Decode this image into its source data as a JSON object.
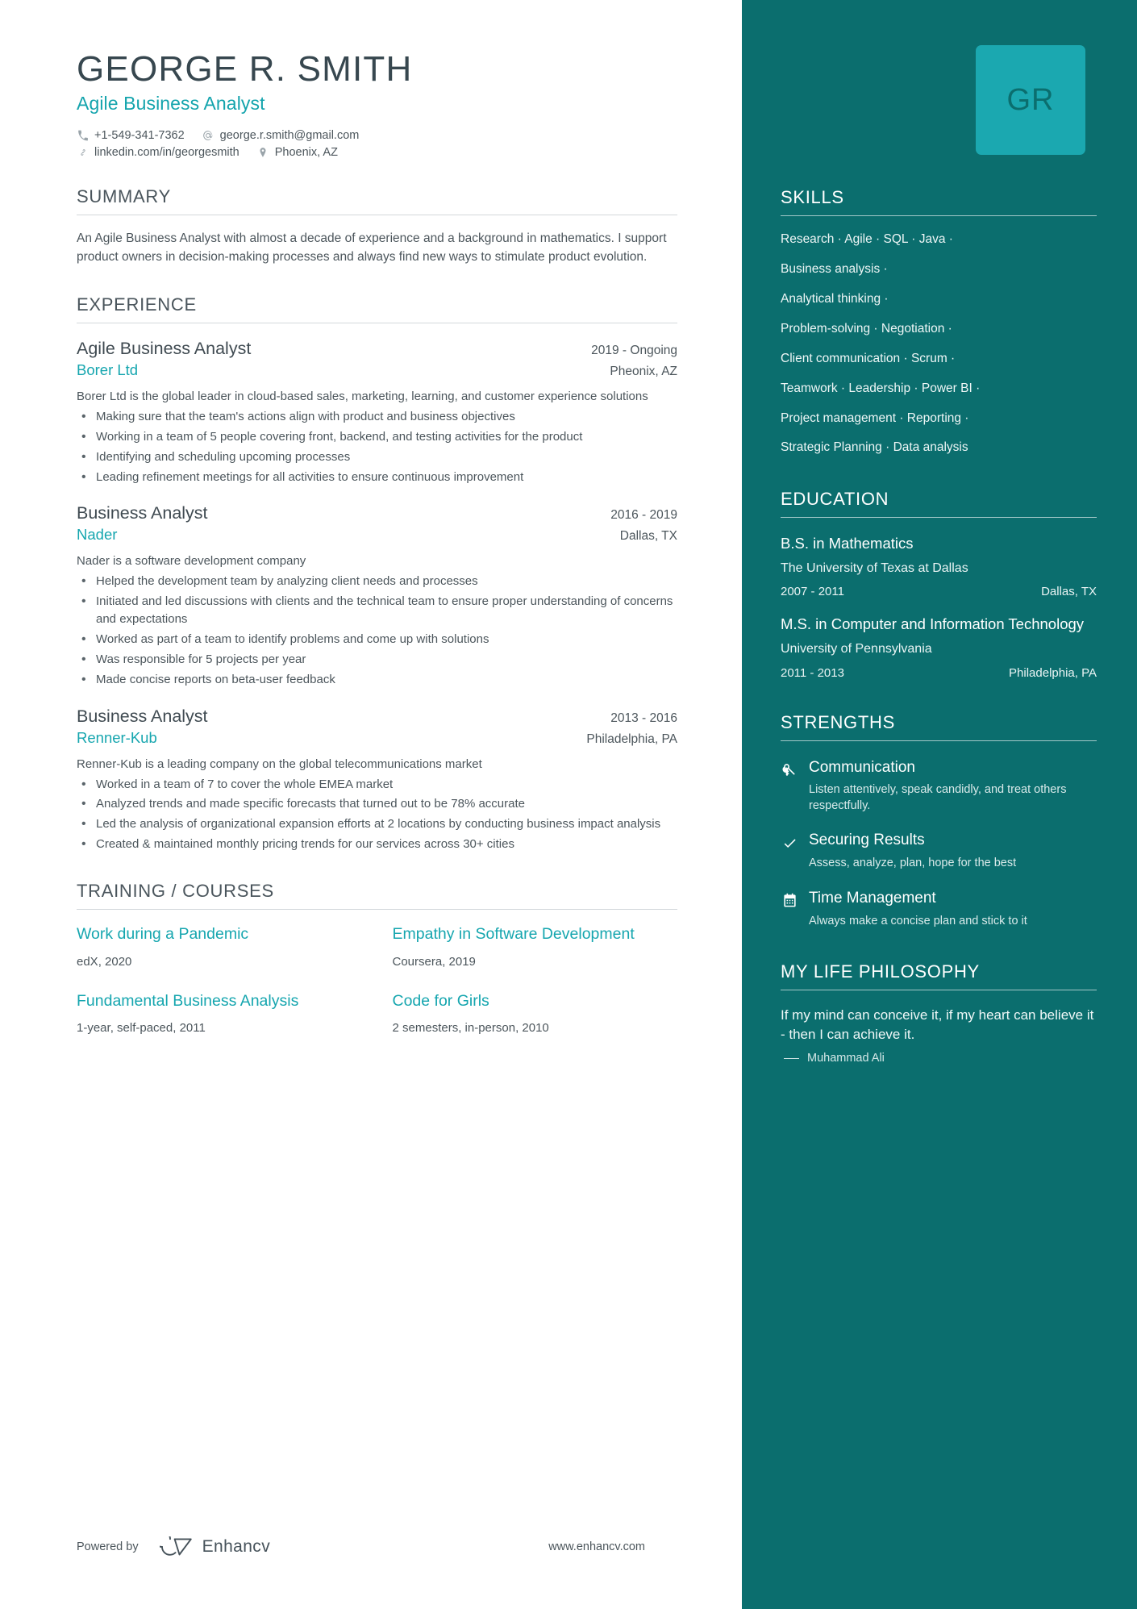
{
  "header": {
    "name": "GEORGE R. SMITH",
    "headline": "Agile Business Analyst",
    "monogram": "GR",
    "contacts_row1": [
      {
        "icon": "phone-icon",
        "text": "+1-549-341-7362"
      },
      {
        "icon": "email-icon",
        "text": "george.r.smith@gmail.com"
      }
    ],
    "contacts_row2": [
      {
        "icon": "link-icon",
        "text": "linkedin.com/in/georgesmith"
      },
      {
        "icon": "location-pin-icon",
        "text": "Phoenix, AZ"
      }
    ]
  },
  "summary": {
    "title": "SUMMARY",
    "text": "An Agile Business Analyst with almost a decade of experience and a background in mathematics. I support product owners in decision-making processes and always find new ways to stimulate product evolution."
  },
  "experience": {
    "title": "EXPERIENCE",
    "jobs": [
      {
        "title": "Agile Business Analyst",
        "date": "2019 - Ongoing",
        "company": "Borer Ltd",
        "location": "Pheonix, AZ",
        "description": "Borer Ltd is the global leader in cloud-based sales, marketing, learning, and customer experience solutions",
        "bullets": [
          "Making sure that the team's actions align with product and business objectives",
          "Working in a team of 5 people covering front, backend, and testing activities for the product",
          "Identifying and scheduling upcoming processes",
          "Leading refinement meetings for all activities to ensure continuous improvement"
        ]
      },
      {
        "title": "Business Analyst",
        "date": "2016 - 2019",
        "company": "Nader",
        "location": "Dallas, TX",
        "description": "Nader is a software development company",
        "bullets": [
          "Helped the development team by analyzing client needs and processes",
          "Initiated and led discussions with clients and the technical team to ensure proper understanding of concerns and expectations",
          "Worked as part of a team to identify problems and come up with solutions",
          "Was responsible for 5 projects per year",
          "Made concise reports on beta-user feedback"
        ]
      },
      {
        "title": "Business Analyst",
        "date": "2013 - 2016",
        "company": "Renner-Kub",
        "location": "Philadelphia, PA",
        "description": "Renner-Kub is a leading company on the global telecommunications market",
        "bullets": [
          "Worked in a team of 7 to cover the whole EMEA market",
          "Analyzed trends and made specific forecasts that turned out to be 78% accurate",
          "Led the analysis of organizational expansion efforts at 2 locations by conducting business impact analysis",
          "Created & maintained monthly pricing trends for our services across 30+ cities"
        ]
      }
    ]
  },
  "training": {
    "title": "TRAINING / COURSES",
    "courses": [
      {
        "name": "Work during a Pandemic",
        "meta": "edX, 2020"
      },
      {
        "name": "Empathy in Software Development",
        "meta": "Coursera, 2019"
      },
      {
        "name": "Fundamental Business Analysis",
        "meta": "1-year, self-paced, 2011"
      },
      {
        "name": "Code for Girls",
        "meta": "2 semesters, in-person, 2010"
      }
    ]
  },
  "skills": {
    "title": "SKILLS",
    "lines": [
      "Research · Agile · SQL · Java ·",
      "Business analysis ·",
      "Analytical thinking ·",
      "Problem-solving · Negotiation ·",
      "Client communication · Scrum ·",
      "Teamwork · Leadership · Power BI ·",
      "Project management · Reporting ·",
      "Strategic Planning · Data analysis"
    ]
  },
  "education": {
    "title": "EDUCATION",
    "items": [
      {
        "degree": "B.S. in Mathematics",
        "school": "The University of Texas at Dallas",
        "years": "2007 - 2011",
        "location": "Dallas, TX"
      },
      {
        "degree": "M.S. in Computer and Information Technology",
        "school": "University of Pennsylvania",
        "years": "2011 - 2013",
        "location": "Philadelphia, PA"
      }
    ]
  },
  "strengths": {
    "title": "STRENGTHS",
    "items": [
      {
        "icon": "key-icon",
        "name": "Communication",
        "desc": "Listen attentively, speak candidly, and treat others respectfully."
      },
      {
        "icon": "check-icon",
        "name": "Securing Results",
        "desc": "Assess, analyze, plan, hope for the best"
      },
      {
        "icon": "calendar-icon",
        "name": "Time Management",
        "desc": "Always make a concise plan and stick to it"
      }
    ]
  },
  "philosophy": {
    "title": "MY LIFE PHILOSOPHY",
    "quote": "If my mind can conceive it, if my heart can believe it - then I can achieve it.",
    "author": "Muhammad Ali"
  },
  "footer": {
    "powered_by": "Powered by",
    "brand": "Enhancv",
    "url": "www.enhancv.com"
  },
  "colors": {
    "sidebar_bg": "#0b6e6e",
    "accent_teal": "#16a6af",
    "avatar_bg": "#1ba8b0",
    "heading_gray": "#4a555c",
    "body_gray": "#4c565c"
  }
}
